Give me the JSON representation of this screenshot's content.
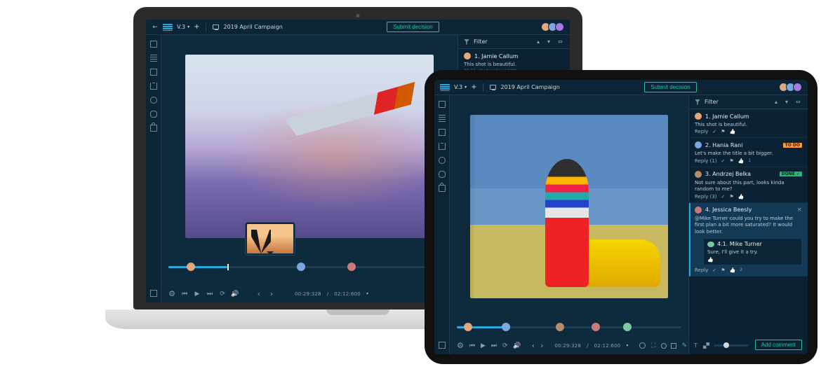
{
  "colors": {
    "accent": "#29a9e0",
    "teal": "#21c6a3",
    "panel": "#0a2233",
    "bg": "#0e2a3d"
  },
  "header": {
    "version": "V.3",
    "project": "2019 April Campaign",
    "submit_label": "Submit decision",
    "avatars": [
      "#e2a77a",
      "#7aa7e2",
      "#a77ae2"
    ]
  },
  "panel": {
    "filter_label": "Filter"
  },
  "footer": {
    "add_comment_label": "Add comment",
    "zoom": "22%"
  },
  "playback": {
    "laptop": {
      "current": "00:29:328",
      "total": "02:12:600",
      "progress_pct": 21,
      "markers_pct": [
        8,
        47,
        65
      ]
    },
    "tablet": {
      "current": "00:29:328",
      "total": "02:12:600",
      "progress_pct": 21,
      "markers_pct": [
        5,
        22,
        46,
        62,
        76
      ]
    }
  },
  "laptop_comments": [
    {
      "id": 1,
      "author": "Jamie Callum",
      "title": "1. Jamie Callum",
      "body": "This shot is beautiful.",
      "meta": "09:15, Wednesday 19/09",
      "reply_label": "Reply",
      "avatar": "#e2a77a"
    }
  ],
  "tablet_comments": [
    {
      "id": 1,
      "author": "Jamie Callum",
      "title": "1. Jamie Callum",
      "body": "This shot is beautiful.",
      "reply_label": "Reply",
      "avatar": "#e2a77a"
    },
    {
      "id": 2,
      "author": "Hania Rani",
      "title": "2. Hania Rani",
      "body": "Let's make the title a bit bigger.",
      "reply_label": "Reply (1)",
      "like_count": "1",
      "badge": "TO DO",
      "badge_kind": "todo",
      "avatar": "#7aa7e2"
    },
    {
      "id": 3,
      "author": "Andrzej Belka",
      "title": "3. Andrzej Belka",
      "body": "Not sure about this part, looks kinda random to me?",
      "reply_label": "Reply (3)",
      "badge": "DONE ✓",
      "badge_kind": "done",
      "avatar": "#b78b6b"
    },
    {
      "id": 4,
      "author": "Jessica Beesly",
      "title": "4. Jessica Beesly",
      "body": "@Mike Turner could you try to make the first plan a bit more saturated? It would look better.",
      "reply_label": "Reply",
      "like_count": "2",
      "highlighted": true,
      "avatar": "#c97a7a",
      "reply": {
        "title": "4.1. Mike Turner",
        "body": "Sure, I'll give it a try.",
        "avatar": "#7ac9a1"
      }
    }
  ]
}
